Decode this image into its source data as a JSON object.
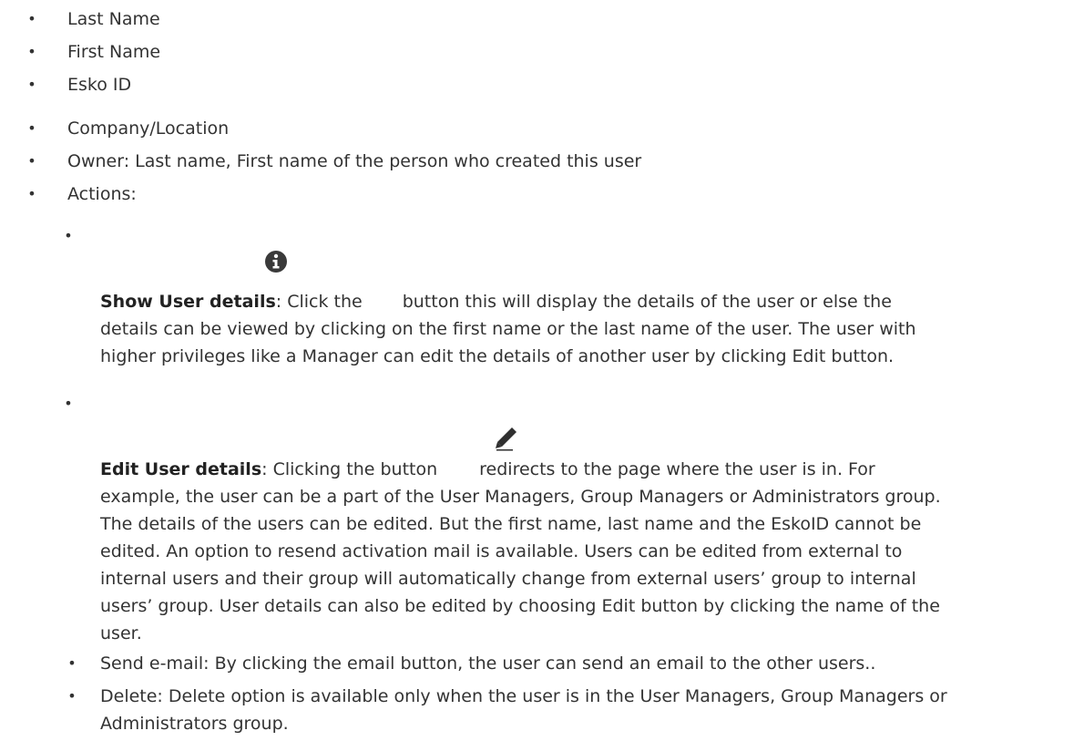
{
  "fields": [
    "Last Name",
    "First Name",
    "Esko ID",
    "Company/Location",
    "Owner: Last name, First name of the person who created this user",
    "Actions:"
  ],
  "actions": {
    "show_details": {
      "title": "Show User details",
      "lines": [
        ": Click the",
        "button this will display the details of the user or else the",
        "details can be viewed by clicking on the first name or the last name of the user. The user with",
        "higher privileges like a Manager can edit the details of another user by clicking Edit button."
      ],
      "icon": "info-icon"
    },
    "edit_details": {
      "title": "Edit User details",
      "lines": [
        ": Clicking the button",
        "redirects to the page where the user is in. For",
        "example, the user can be a part of the User Managers, Group Managers or Administrators group.",
        "The details of the users can be edited. But the first name, last name and the EskoID cannot be",
        "edited. An option to resend activation mail is available. Users can be edited from external to",
        "internal users and their group will automatically change from external users’ group to internal",
        "users’ group. User details can also be edited by choosing Edit button by clicking the name of the",
        "user."
      ],
      "icon": "pencil-icon"
    },
    "send_email": "Send e-mail: By clicking the email button, the user can send an email to the other users..",
    "delete": {
      "line1": "Delete: Delete option is available only when the user is in the User Managers, Group Managers or",
      "line2": "Administrators group."
    }
  },
  "bullet_glyph": "•"
}
